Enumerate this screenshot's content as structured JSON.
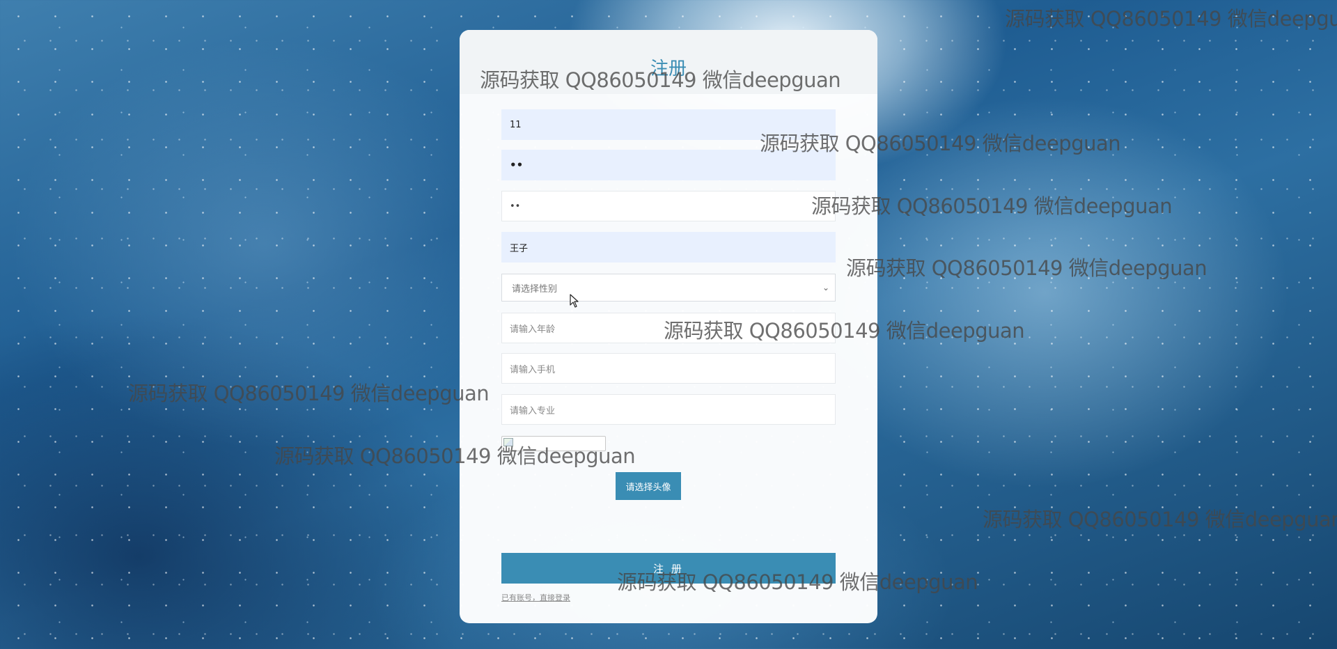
{
  "register": {
    "title": "注册",
    "fields": {
      "account": "11",
      "password": "••",
      "confirm_password": "••",
      "name": "王子",
      "gender_placeholder": "请选择性别",
      "age_placeholder": "请输入年龄",
      "phone_placeholder": "请输入手机",
      "major_placeholder": "请输入专业"
    },
    "choose_avatar_label": "请选择头像",
    "submit_label": "注 册",
    "login_link": "已有账号，直接登录"
  },
  "watermark_text": "源码获取 QQ86050149 微信deepguan",
  "colors": {
    "accent": "#3a8db4",
    "autofill_bg": "#e8f0fe"
  }
}
